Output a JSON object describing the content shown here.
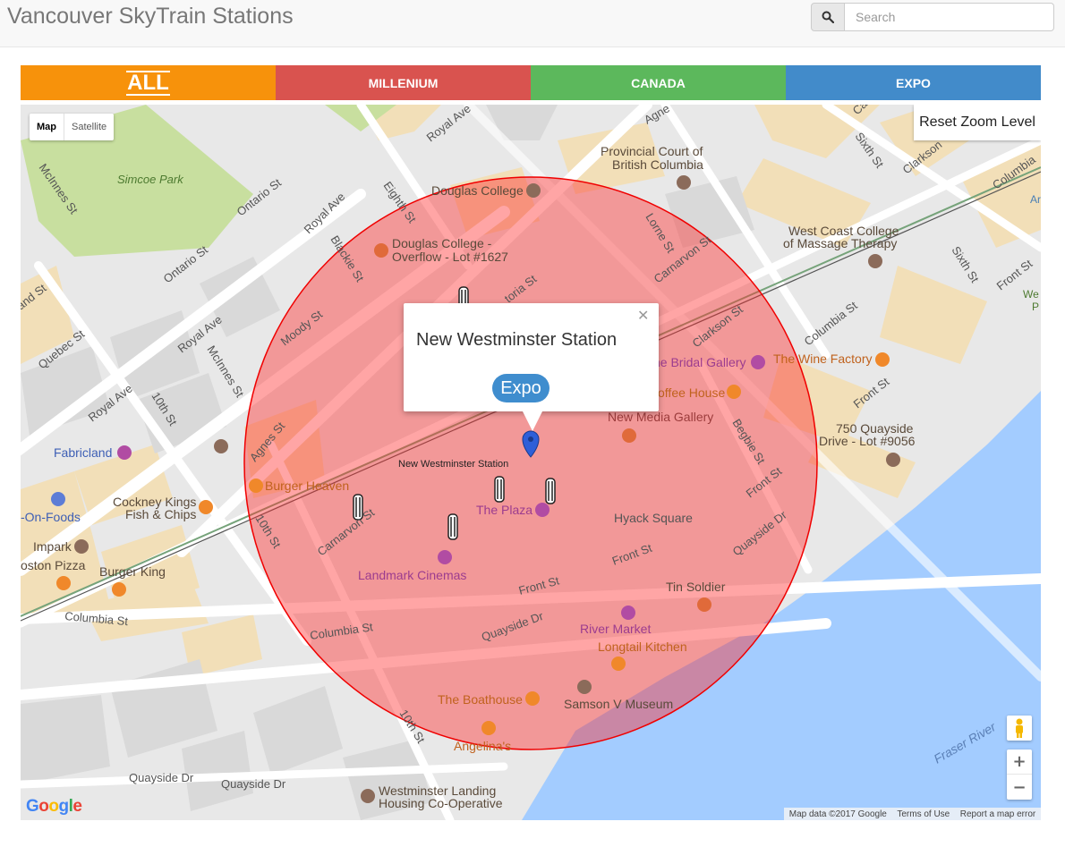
{
  "app": {
    "title": "Vancouver SkyTrain Stations"
  },
  "search": {
    "placeholder": "Search",
    "icon": "search-icon"
  },
  "tabs": [
    {
      "label": "ALL",
      "color": "#f7920b"
    },
    {
      "label": "MILLENIUM",
      "color": "#d9534f"
    },
    {
      "label": "CANADA",
      "color": "#5cb85c"
    },
    {
      "label": "EXPO",
      "color": "#428bca"
    }
  ],
  "map": {
    "type_controls": {
      "map_label": "Map",
      "satellite_label": "Satellite",
      "selected": "Map"
    },
    "reset_label": "Reset Zoom Level",
    "radius_color": "#f00000",
    "water_color": "#a3ccff",
    "park_color": "#c8df9f",
    "labels": {
      "simcoe_park": "Simcoe Park",
      "mcinnes_st": "McInnes St",
      "royal_ave_top": "Royal Ave",
      "agnes_top": "Agne",
      "ca_top": "Ca",
      "provincial_court_1": "Provincial Court of",
      "provincial_court_2": "British Columbia",
      "sixth_st": "Sixth St",
      "clarkson_top": "Clarkson",
      "columbia_right": "Columbia",
      "ar_right": "Ar",
      "douglas_college": "Douglas College",
      "ontario_st": "Ontario St",
      "eighth_st": "Eighth St",
      "royal_ave_mid": "Royal Ave",
      "lorne_st": "Lorne St",
      "west_coast_1": "West Coast College",
      "west_coast_2": "of Massage Therapy",
      "sixth_st_2": "Sixth St",
      "front_st_right": "Front St",
      "we_right": "We",
      "p_right": "P",
      "blackie_st": "Blackie St",
      "ontario_st_2": "Ontario St",
      "douglas_overflow_1": "Douglas College -",
      "douglas_overflow_2": "Overflow - Lot #1627",
      "carnarvon_top": "Carnarvon St",
      "and_st": "and St",
      "toria_st": "toria St",
      "moody_st": "Moody St",
      "clarkson_st": "Clarkson St",
      "columbia_st_mid": "Columbia St",
      "quebec_st": "Quebec St",
      "royal_ave_left": "Royal Ave",
      "mcinnes_st_2": "McInnes St",
      "bridal_gallery": "he Bridal Gallery",
      "wine_factory": "The Wine Factory",
      "coffee_house": "offee House",
      "front_st_mid": "Front St",
      "royal_ave_lower": "Royal Ave",
      "tenth_st_top": "10th St",
      "new_media_gallery": "New Media Gallery",
      "begbie_st": "Begbie St",
      "quayside_lot_1": "750 Quayside",
      "quayside_lot_2": "Drive - Lot #9056",
      "fabricland": "Fabricland",
      "agnes_st": "Agnes St",
      "station_label": "New Westminster Station",
      "front_st_2": "Front St",
      "burger_heaven": "Burger Heaven",
      "on_foods": "-On-Foods",
      "cockney_1": "Cockney Kings",
      "cockney_2": "Fish & Chips",
      "carnarvon_st": "Carnarvon St",
      "the_plaza": "The Plaza",
      "hyack_square": "Hyack Square",
      "quayside_dr_right": "Quayside Dr",
      "impark": "Impark",
      "tenth_st_left": "10th St",
      "landmark_cinemas": "Landmark Cinemas",
      "front_st_lower": "Front St",
      "front_st_lower2": "Front St",
      "boston_pizza": "oston Pizza",
      "burger_king": "Burger King",
      "tin_soldier": "Tin Soldier",
      "columbia_st_left": "Columbia St",
      "columbia_st_lower": "Columbia St",
      "quayside_dr_mid": "Quayside Dr",
      "river_market": "River Market",
      "longtail_kitchen": "Longtail Kitchen",
      "the_boathouse": "The Boathouse",
      "samson_museum": "Samson V Museum",
      "tenth_st_bottom": "10th St",
      "fraser_river": "Fraser River",
      "angelinas": "Angelina's",
      "quayside_dr_bl": "Quayside Dr",
      "quayside_dr_bl2": "Quayside Dr",
      "westminster_landing_1": "Westminster Landing",
      "westminster_landing_2": "Housing Co-Operative"
    },
    "info_window": {
      "title": "New Westminster Station",
      "line": "Expo",
      "line_color": "#428bca"
    },
    "attribution": {
      "data": "Map data ©2017 Google",
      "terms": "Terms of Use",
      "report": "Report a map error"
    },
    "logo": "Google"
  }
}
